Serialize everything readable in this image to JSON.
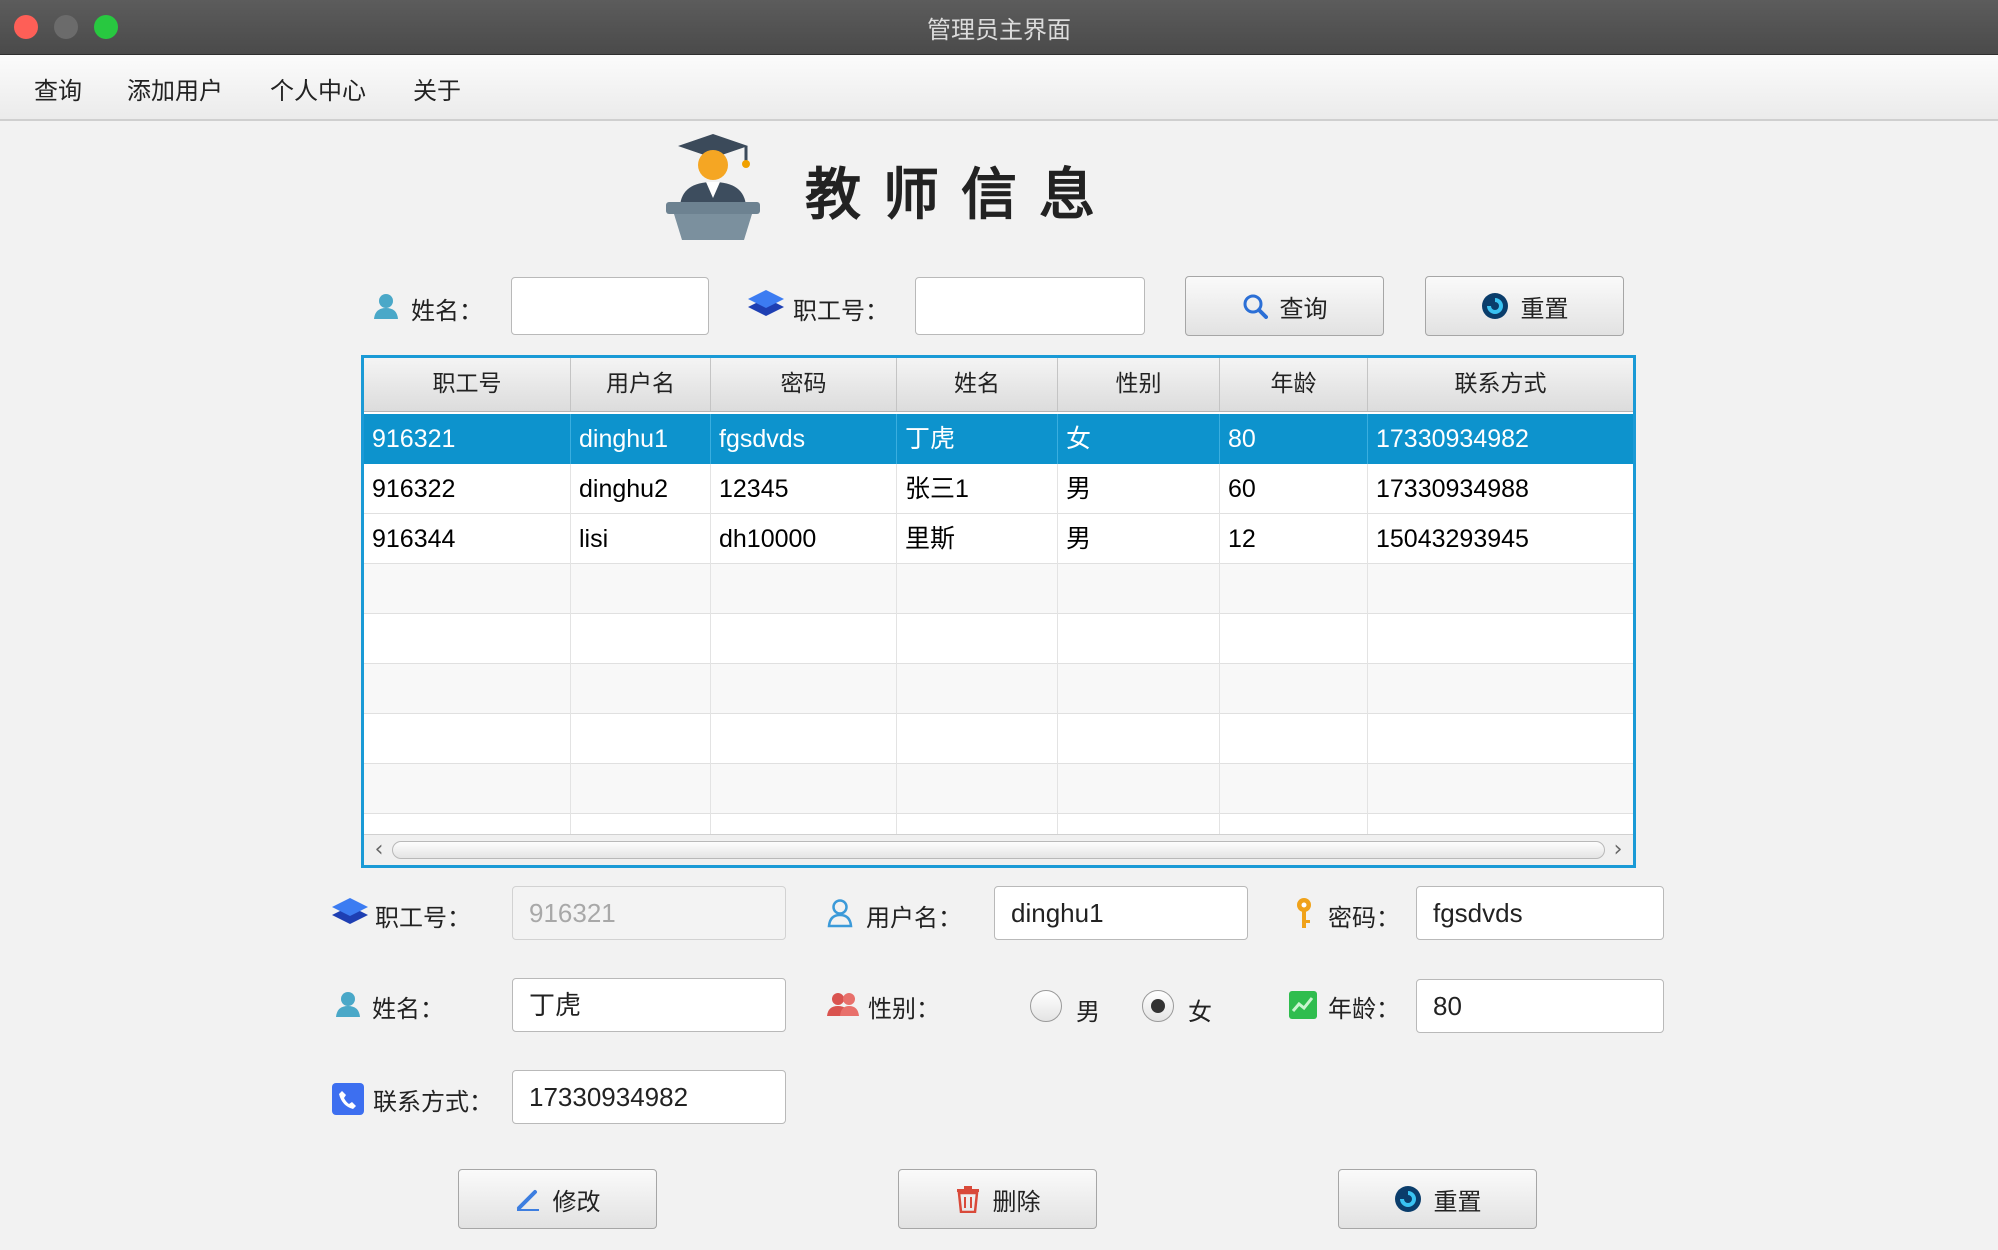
{
  "window": {
    "title": "管理员主界面"
  },
  "menu": [
    "查询",
    "添加用户",
    "个人中心",
    "关于"
  ],
  "header": {
    "title": "教师信息"
  },
  "search": {
    "name_label": "姓名：",
    "name_value": "",
    "id_label": "职工号：",
    "id_value": "",
    "query_button": "查询",
    "reset_button": "重置"
  },
  "table": {
    "columns": [
      "职工号",
      "用户名",
      "密码",
      "姓名",
      "性别",
      "年龄",
      "联系方式"
    ],
    "rows": [
      [
        "916321",
        "dinghu1",
        "fgsdvds",
        "丁虎",
        "女",
        "80",
        "17330934982"
      ],
      [
        "916322",
        "dinghu2",
        "12345",
        "张三1",
        "男",
        "60",
        "17330934988"
      ],
      [
        "916344",
        "lisi",
        "dh10000",
        "里斯",
        "男",
        "12",
        "15043293945"
      ]
    ],
    "selected_row": 0
  },
  "form": {
    "id_label": "职工号：",
    "id_value": "916321",
    "username_label": "用户名：",
    "username_value": "dinghu1",
    "password_label": "密码：",
    "password_value": "fgsdvds",
    "name_label": "姓名：",
    "name_value": "丁虎",
    "gender_label": "性别：",
    "gender_male": "男",
    "gender_female": "女",
    "gender_selected": "女",
    "age_label": "年龄：",
    "age_value": "80",
    "phone_label": "联系方式：",
    "phone_value": "17330934982"
  },
  "actions": {
    "modify": "修改",
    "delete": "删除",
    "reset": "重置"
  },
  "colors": {
    "accent": "#0d93cd",
    "table_border": "#1a9ad6"
  }
}
